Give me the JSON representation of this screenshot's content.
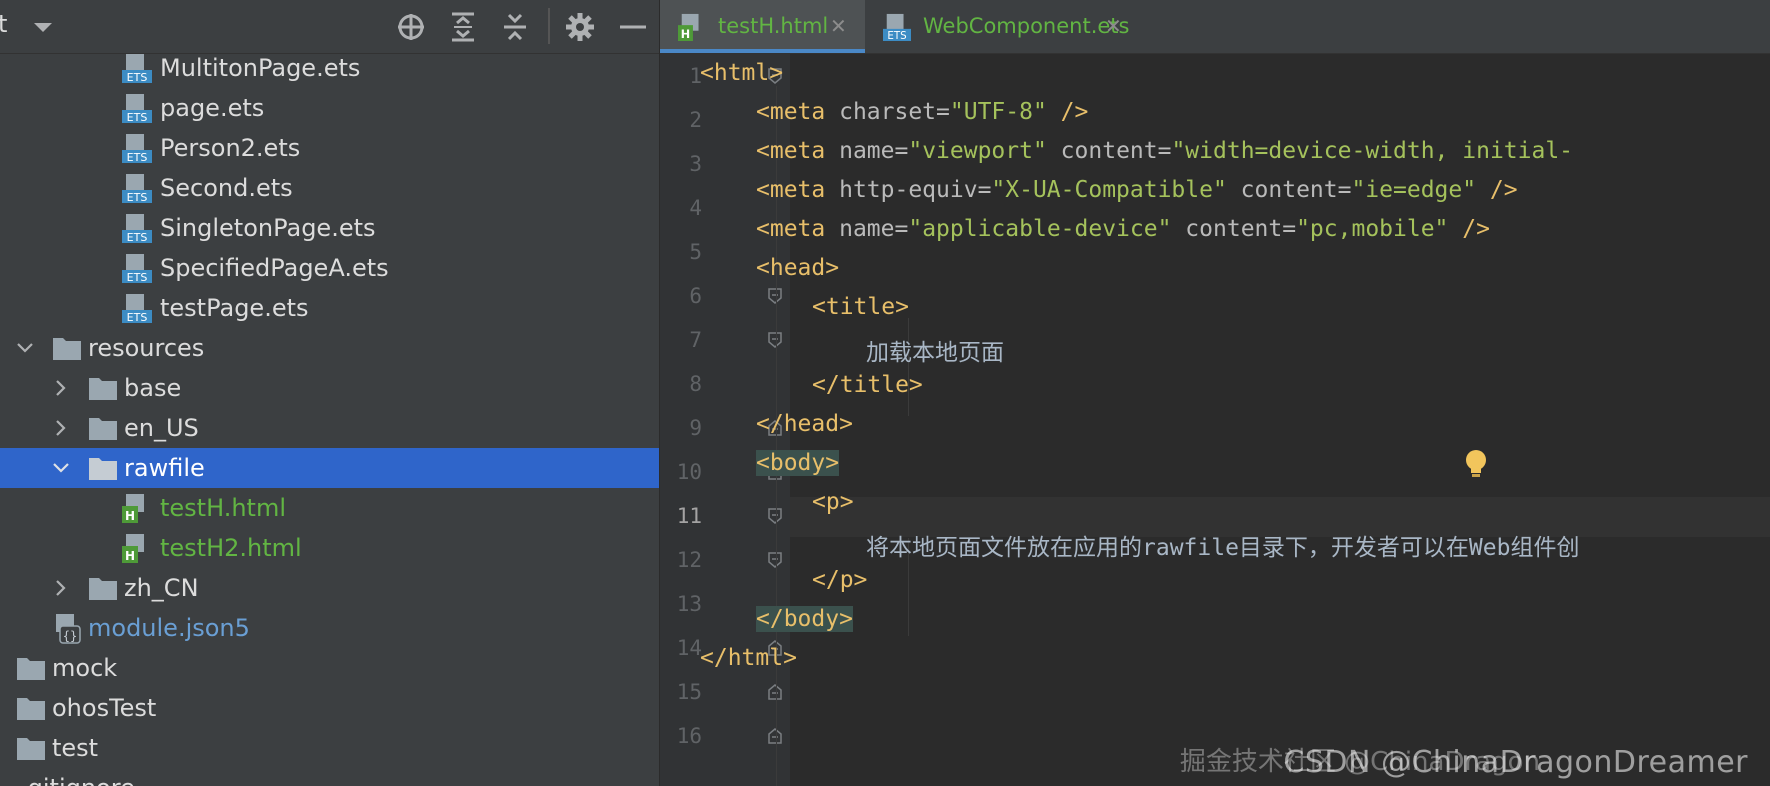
{
  "project_panel": {
    "toolbar_title_fragment": "t",
    "tree": [
      {
        "label": "MultitonPage.ets",
        "type": "ets"
      },
      {
        "label": "page.ets",
        "type": "ets"
      },
      {
        "label": "Person2.ets",
        "type": "ets"
      },
      {
        "label": "Second.ets",
        "type": "ets"
      },
      {
        "label": "SingletonPage.ets",
        "type": "ets"
      },
      {
        "label": "SpecifiedPageA.ets",
        "type": "ets"
      },
      {
        "label": "testPage.ets",
        "type": "ets"
      },
      {
        "label": "resources",
        "type": "folder",
        "expanded": true
      },
      {
        "label": "base",
        "type": "folder",
        "expanded": false
      },
      {
        "label": "en_US",
        "type": "folder",
        "expanded": false
      },
      {
        "label": "rawfile",
        "type": "folder",
        "expanded": true,
        "selected": true
      },
      {
        "label": "testH.html",
        "type": "html"
      },
      {
        "label": "testH2.html",
        "type": "html"
      },
      {
        "label": "zh_CN",
        "type": "folder",
        "expanded": false
      },
      {
        "label": "module.json5",
        "type": "json"
      },
      {
        "label": "mock",
        "type": "folder"
      },
      {
        "label": "ohosTest",
        "type": "folder"
      },
      {
        "label": "test",
        "type": "folder"
      },
      {
        "label": ".gitignore",
        "type": "file"
      }
    ]
  },
  "editor": {
    "tabs": [
      {
        "label": "testH.html",
        "active": true,
        "icon": "html-file-icon"
      },
      {
        "label": "WebComponent.ets",
        "active": false,
        "icon": "ets-file-icon"
      }
    ],
    "close_glyph": "✕",
    "current_line": 11,
    "line_numbers": [
      "1",
      "2",
      "3",
      "4",
      "5",
      "6",
      "7",
      "8",
      "9",
      "10",
      "11",
      "12",
      "13",
      "14",
      "15",
      "16"
    ],
    "lines": {
      "l1": [
        "<html>"
      ],
      "l2": [
        "<meta",
        " charset=",
        "\"UTF-8\"",
        " />"
      ],
      "l3": [
        "<meta",
        " name=",
        "\"viewport\"",
        " content=",
        "\"width=device-width, initial-"
      ],
      "l4": [
        "<meta",
        " http-equiv=",
        "\"X-UA-Compatible\"",
        " content=",
        "\"ie=edge\"",
        " />"
      ],
      "l5": [
        "<meta",
        " name=",
        "\"applicable-device\"",
        " content=",
        "\"pc,mobile\"",
        " />"
      ],
      "l6": [
        "<head>"
      ],
      "l7": [
        "<title>"
      ],
      "l8": [
        "加载本地页面"
      ],
      "l9": [
        "</title>"
      ],
      "l10": [
        "</head>"
      ],
      "l11": [
        "<body>"
      ],
      "l12": [
        "<p>"
      ],
      "l13": [
        "将本地页面文件放在应用的rawfile目录下，开发者可以在Web组件创"
      ],
      "l14": [
        "</p>"
      ],
      "l15": [
        "</body>"
      ],
      "l16": [
        "</html>"
      ]
    }
  },
  "watermark": "CSDN @ChinaDragonDreamer",
  "watermark_overlay": "掘金技术社区 @ChinaDragon",
  "colors": {
    "panel_bg": "#3c3f41",
    "editor_bg": "#2b2b2b",
    "selection": "#2f65ca",
    "tag": "#e8bf6a",
    "attr_value": "#a5c25c",
    "html_file": "#62b543"
  }
}
